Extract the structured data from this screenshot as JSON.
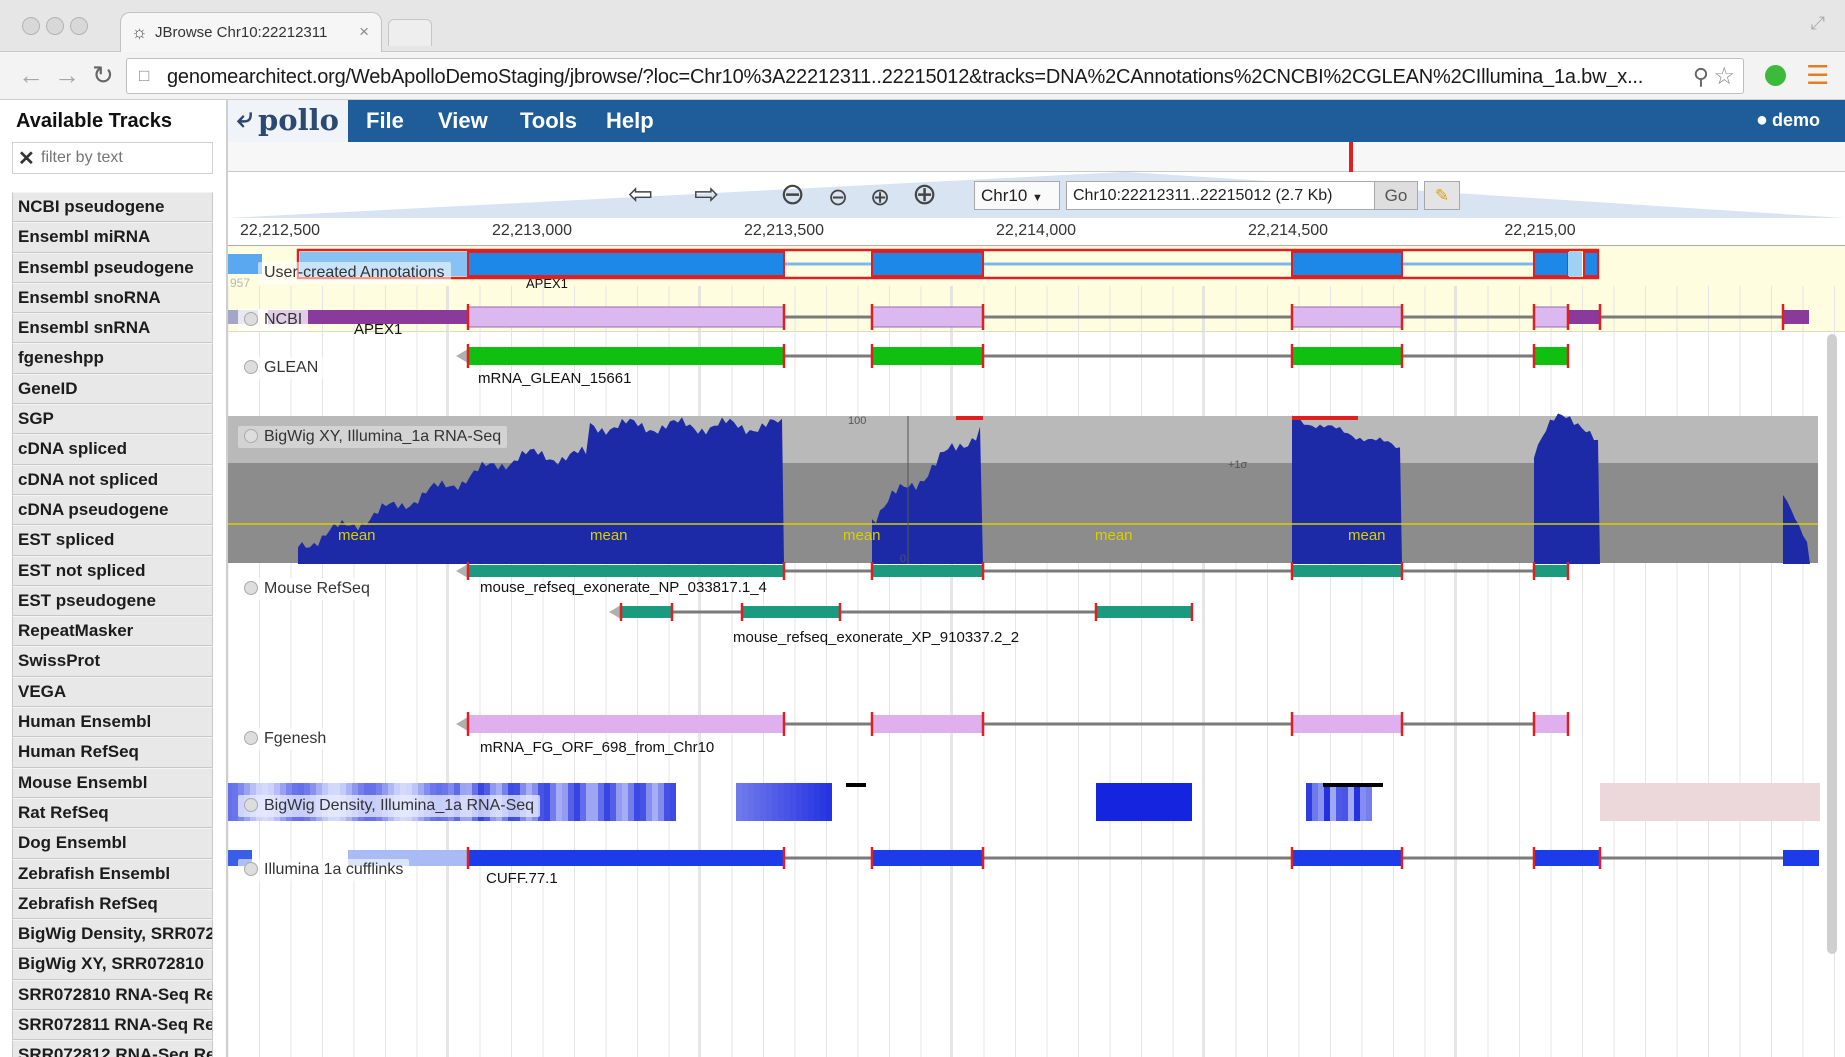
{
  "browser": {
    "tab_title": "JBrowse Chr10:22212311",
    "tab_close": "×",
    "url": "genomearchitect.org/WebApolloDemoStaging/jbrowse/?loc=Chr10%3A22212311..22215012&tracks=DNA%2CAnnotations%2CNCBI%2CGLEAN%2CIllumina_1a.bw_x..."
  },
  "sidebar": {
    "title": "Available Tracks",
    "filter_placeholder": "filter by text",
    "tracks": [
      "NCBI pseudogene",
      "Ensembl miRNA",
      "Ensembl pseudogene",
      "Ensembl snoRNA",
      "Ensembl snRNA",
      "fgeneshpp",
      "GeneID",
      "SGP",
      "cDNA spliced",
      "cDNA not spliced",
      "cDNA pseudogene",
      "EST spliced",
      "EST not spliced",
      "EST pseudogene",
      "RepeatMasker",
      "SwissProt",
      "VEGA",
      "Human Ensembl",
      "Human RefSeq",
      "Mouse Ensembl",
      "Rat RefSeq",
      "Dog Ensembl",
      "Zebrafish Ensembl",
      "Zebrafish RefSeq",
      "BigWig Density, SRR072",
      "BigWig XY, SRR072810",
      "SRR072810 RNA-Seq Re",
      "SRR072811 RNA-Seq Re",
      "SRR072812 RNA-Seq Re"
    ]
  },
  "menubar": {
    "logo": "pollo",
    "file": "File",
    "view": "View",
    "tools": "Tools",
    "help": "Help",
    "user": "demo"
  },
  "navbox": {
    "refseq": "Chr10",
    "location": "Chr10:22212311..22215012 (2.7 Kb)",
    "go": "Go"
  },
  "ruler": {
    "ticks": [
      "22,212,500",
      "22,213,000",
      "22,213,500",
      "22,214,000",
      "22,214,500",
      "22,215,00"
    ]
  },
  "tracks": {
    "user_annotations": {
      "label": "User-created Annotations",
      "feature": "APEX1",
      "side_number": "957"
    },
    "ncbi": {
      "label": "NCBI",
      "feature": "APEX1"
    },
    "glean": {
      "label": "GLEAN",
      "feature": "mRNA_GLEAN_15661"
    },
    "bigwig_xy": {
      "label": "BigWig XY, Illumina_1a RNA-Seq",
      "max_label": "100",
      "min_label": "0",
      "sd_label": "+1σ",
      "mean_label": "mean"
    },
    "mouse_refseq": {
      "label": "Mouse RefSeq",
      "feature1": "mouse_refseq_exonerate_NP_033817.1_4",
      "feature2": "mouse_refseq_exonerate_XP_910337.2_2"
    },
    "fgenesh": {
      "label": "Fgenesh",
      "feature": "mRNA_FG_ORF_698_from_Chr10"
    },
    "bigwig_density": {
      "label": "BigWig Density, Illumina_1a RNA-Seq"
    },
    "cufflinks": {
      "label": "Illumina 1a cufflinks",
      "feature": "CUFF.77.1"
    }
  },
  "colors": {
    "menubar": "#1f5d9a",
    "annotation_blue": "#1e88e8",
    "ncbi_exon": "#dcb8f0",
    "ncbi_utr": "#8a3a9a",
    "glean_green": "#10c010",
    "coverage_blue": "#1c2aa8",
    "refseq_teal": "#1b9a80",
    "fgenesh_pink": "#e0b0ee",
    "cufflinks_blue": "#1b3ce8",
    "boundary_red": "#e02020"
  }
}
